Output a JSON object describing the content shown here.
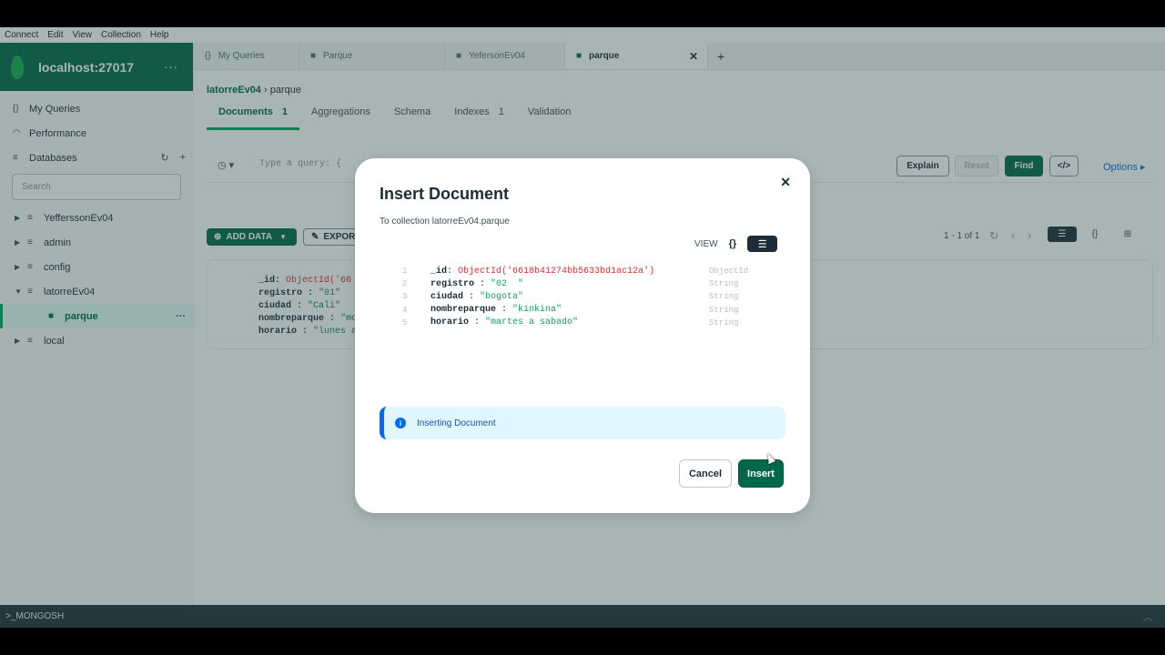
{
  "menubar": [
    "Connect",
    "Edit",
    "View",
    "Collection",
    "Help"
  ],
  "connection": {
    "host": "localhost:27017",
    "more": "···"
  },
  "sidebar": {
    "my_queries": "My Queries",
    "performance": "Performance",
    "databases": "Databases",
    "search_placeholder": "Search",
    "dbs": [
      "YefferssonEv04",
      "admin",
      "config",
      "latorreEv04",
      "local"
    ],
    "active_collection": "parque",
    "more": "···"
  },
  "tabs": [
    {
      "icon": "{}",
      "label": "My Queries"
    },
    {
      "icon": "■",
      "label": "Parque"
    },
    {
      "icon": "■",
      "label": "YefersonEv04"
    },
    {
      "icon": "■",
      "label": "parque"
    }
  ],
  "breadcrumb": {
    "db": "latorreEv04",
    "sep": "›",
    "collection": "parque"
  },
  "subtabs": [
    {
      "label": "Documents",
      "count": "1"
    },
    {
      "label": "Aggregations",
      "count": ""
    },
    {
      "label": "Schema",
      "count": ""
    },
    {
      "label": "Indexes",
      "count": "1"
    },
    {
      "label": "Validation",
      "count": ""
    }
  ],
  "query": {
    "placeholder": "Type a query: {",
    "explain": "Explain",
    "reset": "Reset",
    "find": "Find",
    "code": "</>",
    "options": "Options ▸"
  },
  "toolbar": {
    "add_data": "ADD DATA",
    "export": "EXPOR",
    "pager": "1 - 1 of 1"
  },
  "document": {
    "lines": [
      {
        "k": "_id",
        "v": "ObjectId('66",
        "type": "oid"
      },
      {
        "k": "registro",
        "v": "\"01\"",
        "type": "str"
      },
      {
        "k": "ciudad",
        "v": "\"Cali\"",
        "type": "str"
      },
      {
        "k": "nombreparque",
        "v": "\"mo",
        "type": "str"
      },
      {
        "k": "horario",
        "v": "\"lunes a",
        "type": "str"
      }
    ]
  },
  "modal": {
    "title": "Insert Document",
    "subtitle": "To collection latorreEv04.parque",
    "view_label": "VIEW",
    "braces": "{}",
    "lines": [
      {
        "n": "1",
        "k": "_id",
        "v": "ObjectId('6618b41274bb5633bd1ac12a')",
        "t": "ObjectId",
        "oid": true
      },
      {
        "n": "2",
        "k": "registro",
        "v": "\"02  \"",
        "t": "String",
        "oid": false
      },
      {
        "n": "3",
        "k": "ciudad",
        "v": "\"bogota\"",
        "t": "String",
        "oid": false
      },
      {
        "n": "4",
        "k": "nombreparque",
        "v": "\"kinkina\"",
        "t": "String",
        "oid": false
      },
      {
        "n": "5",
        "k": "horario",
        "v": "\"martes a sabado\"",
        "t": "String",
        "oid": false
      }
    ],
    "banner": "Inserting Document",
    "cancel": "Cancel",
    "insert": "Insert"
  },
  "shell": {
    "label": ">_MONGOSH"
  },
  "colors": {
    "brand_green": "#00684a",
    "leaf_green": "#13aa52",
    "info_blue": "#016bf8"
  }
}
